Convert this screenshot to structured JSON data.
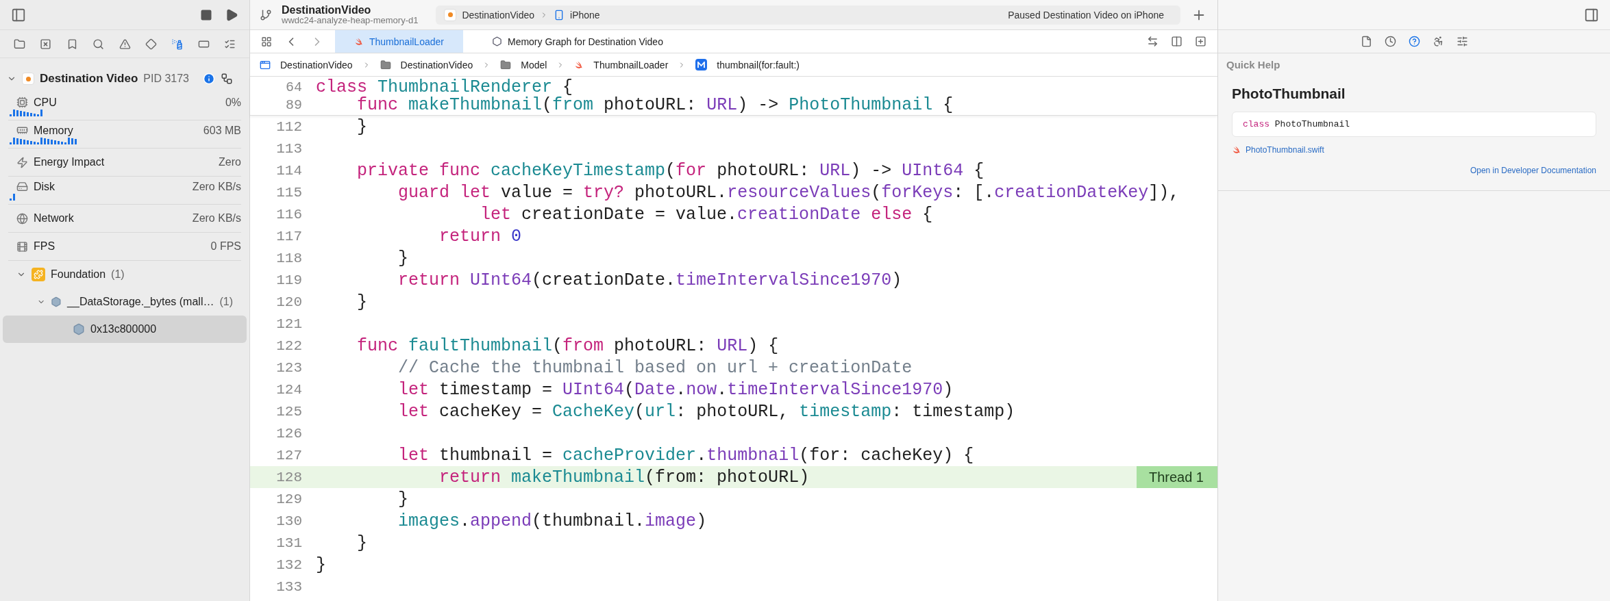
{
  "toolbar": {
    "project": "DestinationVideo",
    "branch": "wwdc24-analyze-heap-memory-d1",
    "scheme": "DestinationVideo",
    "destination": "iPhone",
    "status": "Paused Destination Video on iPhone"
  },
  "navigator_tabs": [
    {
      "selected": false
    },
    {
      "selected": false
    },
    {
      "selected": false
    },
    {
      "selected": false
    },
    {
      "selected": false
    },
    {
      "selected": false
    },
    {
      "selected": true
    },
    {
      "selected": false
    },
    {
      "selected": false
    }
  ],
  "process": {
    "name": "Destination Video",
    "pid": "PID 3173",
    "expanded": true
  },
  "metrics": [
    {
      "kind": "cpu",
      "label": "CPU",
      "value": "0%"
    },
    {
      "kind": "memory",
      "label": "Memory",
      "value": "603 MB"
    },
    {
      "kind": "energy",
      "label": "Energy Impact",
      "value": "Zero"
    },
    {
      "kind": "disk",
      "label": "Disk",
      "value": "Zero KB/s"
    },
    {
      "kind": "network",
      "label": "Network",
      "value": "Zero KB/s"
    },
    {
      "kind": "fps",
      "label": "FPS",
      "value": "0 FPS"
    }
  ],
  "tree": [
    {
      "label": "Foundation",
      "count": "(1)",
      "expanded": true,
      "selected": false,
      "children": [
        {
          "label": "__DataStorage._bytes (mall…",
          "count": "(1)",
          "expanded": true,
          "selected": false,
          "children": [
            {
              "label": "0x13c800000",
              "selected": true
            }
          ]
        }
      ]
    }
  ],
  "editor_tabs": [
    {
      "label": "ThumbnailLoader",
      "selected": true
    },
    {
      "label": "Memory Graph for Destination Video",
      "selected": false
    }
  ],
  "breadcrumb": [
    "DestinationVideo",
    "DestinationVideo",
    "Model",
    "ThumbnailLoader",
    "thumbnail(for:fault:)"
  ],
  "sticky_lines": [
    {
      "number": "64",
      "tokens": [
        {
          "kind": "kw",
          "text": "class "
        },
        {
          "kind": "type",
          "text": "ThumbnailRenderer"
        },
        {
          "kind": "plain",
          "text": " {"
        }
      ]
    },
    {
      "number": "89",
      "tokens": [
        {
          "kind": "kw",
          "text": "    func "
        },
        {
          "kind": "type",
          "text": "makeThumbnail"
        },
        {
          "kind": "plain",
          "text": "("
        },
        {
          "kind": "type",
          "text": "from"
        },
        {
          "kind": "plain",
          "text": " photoURL: "
        },
        {
          "kind": "sys",
          "text": "URL"
        },
        {
          "kind": "plain",
          "text": ") -> "
        },
        {
          "kind": "type",
          "text": "PhotoThumbnail"
        },
        {
          "kind": "plain",
          "text": " {"
        }
      ]
    }
  ],
  "lines": [
    {
      "number": "112",
      "highlighted": false,
      "tokens": [
        {
          "kind": "plain",
          "text": "    }"
        }
      ]
    },
    {
      "number": "113",
      "highlighted": false
    },
    {
      "number": "114",
      "highlighted": false,
      "tokens": [
        {
          "kind": "kw",
          "text": "    private func "
        },
        {
          "kind": "type",
          "text": "cacheKeyTimestamp"
        },
        {
          "kind": "plain",
          "text": "("
        },
        {
          "kind": "kw",
          "text": "for"
        },
        {
          "kind": "plain",
          "text": " photoURL: "
        },
        {
          "kind": "sys",
          "text": "URL"
        },
        {
          "kind": "plain",
          "text": ") -> "
        },
        {
          "kind": "sys",
          "text": "UInt64"
        },
        {
          "kind": "plain",
          "text": " {"
        }
      ]
    },
    {
      "number": "115",
      "highlighted": false,
      "tokens": [
        {
          "kind": "kw",
          "text": "        guard let"
        },
        {
          "kind": "plain",
          "text": " value = "
        },
        {
          "kind": "kw",
          "text": "try?"
        },
        {
          "kind": "plain",
          "text": " photoURL."
        },
        {
          "kind": "sys",
          "text": "resourceValues"
        },
        {
          "kind": "plain",
          "text": "("
        },
        {
          "kind": "sys",
          "text": "forKeys"
        },
        {
          "kind": "plain",
          "text": ": [."
        },
        {
          "kind": "sys",
          "text": "creationDateKey"
        },
        {
          "kind": "plain",
          "text": "]),"
        }
      ]
    },
    {
      "number": "116",
      "highlighted": false,
      "tokens": [
        {
          "kind": "kw",
          "text": "                let"
        },
        {
          "kind": "plain",
          "text": " creationDate = value."
        },
        {
          "kind": "sys",
          "text": "creationDate"
        },
        {
          "kind": "kw",
          "text": " else"
        },
        {
          "kind": "plain",
          "text": " {"
        }
      ]
    },
    {
      "number": "117",
      "highlighted": false,
      "tokens": [
        {
          "kind": "kw",
          "text": "            return "
        },
        {
          "kind": "num",
          "text": "0"
        }
      ]
    },
    {
      "number": "118",
      "highlighted": false,
      "tokens": [
        {
          "kind": "plain",
          "text": "        }"
        }
      ]
    },
    {
      "number": "119",
      "highlighted": false,
      "tokens": [
        {
          "kind": "kw",
          "text": "        return "
        },
        {
          "kind": "sys",
          "text": "UInt64"
        },
        {
          "kind": "plain",
          "text": "(creationDate."
        },
        {
          "kind": "sys",
          "text": "timeIntervalSince1970"
        },
        {
          "kind": "plain",
          "text": ")"
        }
      ]
    },
    {
      "number": "120",
      "highlighted": false,
      "tokens": [
        {
          "kind": "plain",
          "text": "    }"
        }
      ]
    },
    {
      "number": "121",
      "highlighted": false
    },
    {
      "number": "122",
      "highlighted": false,
      "tokens": [
        {
          "kind": "kw",
          "text": "    func "
        },
        {
          "kind": "type",
          "text": "faultThumbnail"
        },
        {
          "kind": "plain",
          "text": "("
        },
        {
          "kind": "kw",
          "text": "from"
        },
        {
          "kind": "plain",
          "text": " photoURL: "
        },
        {
          "kind": "sys",
          "text": "URL"
        },
        {
          "kind": "plain",
          "text": ") {"
        }
      ]
    },
    {
      "number": "123",
      "highlighted": false,
      "tokens": [
        {
          "kind": "comment",
          "text": "        // Cache the thumbnail based on url + creationDate"
        }
      ]
    },
    {
      "number": "124",
      "highlighted": false,
      "tokens": [
        {
          "kind": "kw",
          "text": "        let"
        },
        {
          "kind": "plain",
          "text": " timestamp = "
        },
        {
          "kind": "sys",
          "text": "UInt64"
        },
        {
          "kind": "plain",
          "text": "("
        },
        {
          "kind": "sys",
          "text": "Date"
        },
        {
          "kind": "plain",
          "text": "."
        },
        {
          "kind": "sys",
          "text": "now"
        },
        {
          "kind": "plain",
          "text": "."
        },
        {
          "kind": "sys",
          "text": "timeIntervalSince1970"
        },
        {
          "kind": "plain",
          "text": ")"
        }
      ]
    },
    {
      "number": "125",
      "highlighted": false,
      "tokens": [
        {
          "kind": "kw",
          "text": "        let"
        },
        {
          "kind": "plain",
          "text": " cacheKey = "
        },
        {
          "kind": "type",
          "text": "CacheKey"
        },
        {
          "kind": "plain",
          "text": "("
        },
        {
          "kind": "type",
          "text": "url"
        },
        {
          "kind": "plain",
          "text": ": photoURL, "
        },
        {
          "kind": "type",
          "text": "timestamp"
        },
        {
          "kind": "plain",
          "text": ": timestamp)"
        }
      ]
    },
    {
      "number": "126",
      "highlighted": false
    },
    {
      "number": "127",
      "highlighted": false,
      "tokens": [
        {
          "kind": "kw",
          "text": "        let"
        },
        {
          "kind": "plain",
          "text": " thumbnail = "
        },
        {
          "kind": "type",
          "text": "cacheProvider"
        },
        {
          "kind": "plain",
          "text": "."
        },
        {
          "kind": "sys",
          "text": "thumbnail"
        },
        {
          "kind": "plain",
          "text": "(for: cacheKey) {"
        }
      ]
    },
    {
      "number": "128",
      "highlighted": true,
      "badge": "Thread 1",
      "tokens": [
        {
          "kind": "kw",
          "text": "            return "
        },
        {
          "kind": "type",
          "text": "makeThumbnail"
        },
        {
          "kind": "plain",
          "text": "(from: photoURL)"
        }
      ]
    },
    {
      "number": "129",
      "highlighted": false,
      "tokens": [
        {
          "kind": "plain",
          "text": "        }"
        }
      ]
    },
    {
      "number": "130",
      "highlighted": false,
      "tokens": [
        {
          "kind": "type",
          "text": "        images"
        },
        {
          "kind": "plain",
          "text": "."
        },
        {
          "kind": "sys",
          "text": "append"
        },
        {
          "kind": "plain",
          "text": "(thumbnail."
        },
        {
          "kind": "sys",
          "text": "image"
        },
        {
          "kind": "plain",
          "text": ")"
        }
      ]
    },
    {
      "number": "131",
      "highlighted": false,
      "tokens": [
        {
          "kind": "plain",
          "text": "    }"
        }
      ]
    },
    {
      "number": "132",
      "highlighted": false,
      "tokens": [
        {
          "kind": "plain",
          "text": "}"
        }
      ]
    },
    {
      "number": "133",
      "highlighted": false
    }
  ],
  "inspector_tabs": [
    {
      "selected": false
    },
    {
      "selected": false
    },
    {
      "selected": true
    },
    {
      "selected": false
    },
    {
      "selected": false
    }
  ],
  "quick_help": {
    "heading": "Quick Help",
    "symbol": "PhotoThumbnail",
    "declaration": [
      {
        "kind": "kw",
        "text": "class"
      },
      {
        "kind": "plain",
        "text": " PhotoThumbnail"
      }
    ],
    "file": "PhotoThumbnail.swift",
    "doc_link": "Open in Developer Documentation"
  }
}
